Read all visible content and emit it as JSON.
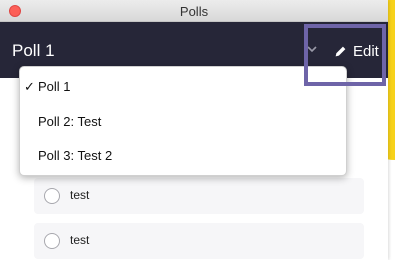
{
  "window": {
    "title": "Polls"
  },
  "header": {
    "poll_title": "Poll 1",
    "edit_label": "Edit"
  },
  "dropdown": {
    "items": [
      {
        "label": "Poll 1",
        "selected": true,
        "check": "✓"
      },
      {
        "label": "Poll 2: Test",
        "selected": false
      },
      {
        "label": "Poll 3: Test 2",
        "selected": false
      }
    ]
  },
  "options": [
    {
      "label": "test"
    },
    {
      "label": "test"
    }
  ],
  "colors": {
    "header_bg": "#262638",
    "highlight_border": "#6e64a8",
    "accent_yellow": "#f7d21b",
    "close_button": "#fc5f57"
  },
  "icons": [
    "close-button-icon",
    "chevron-down-icon",
    "pencil-icon",
    "checkmark-icon",
    "radio-icon"
  ]
}
